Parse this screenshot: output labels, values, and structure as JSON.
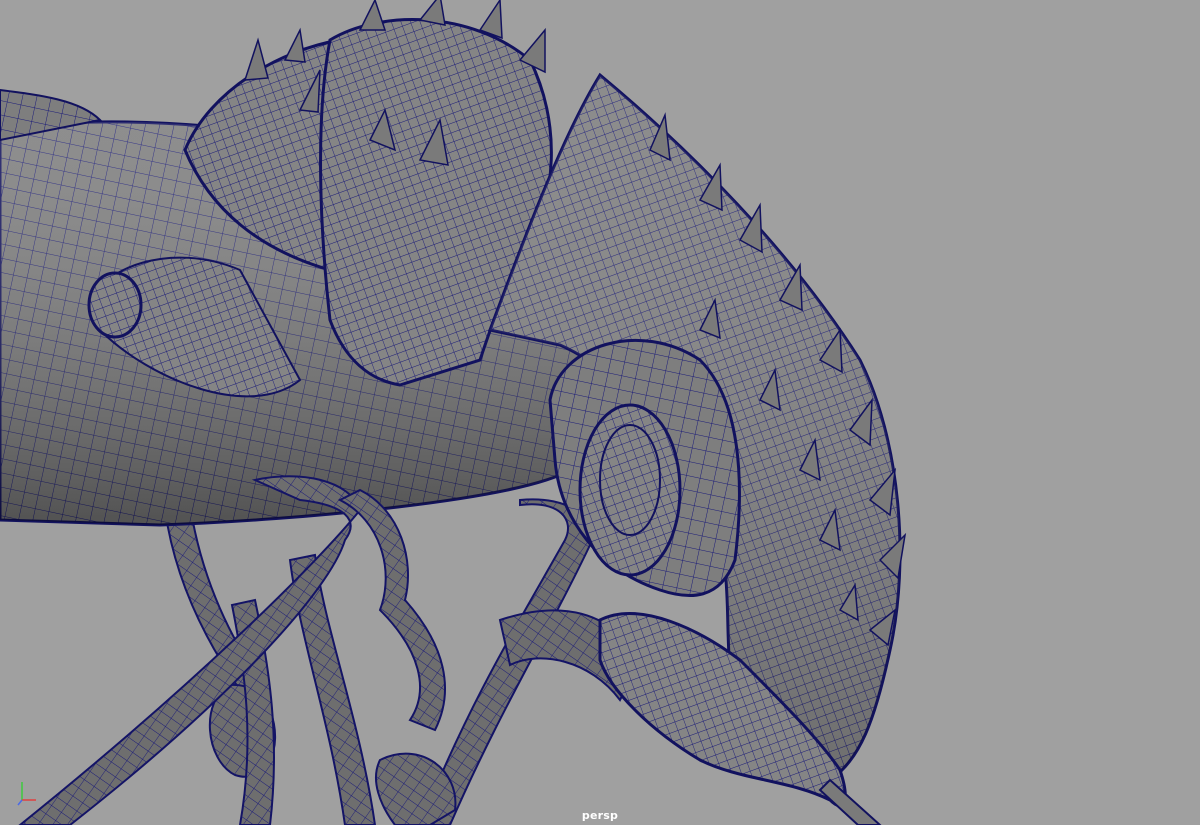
{
  "viewport": {
    "camera_label": "persp",
    "background_color": "#a0a0a0",
    "mesh_fill_color": "#7d7d7d",
    "wireframe_color": "#1a1a7a",
    "object": "insect-creature-model"
  },
  "axis_gizmo": {
    "y_color": "#3dcb3d",
    "x_color": "#e04040",
    "z_color": "#4a6ae8"
  }
}
